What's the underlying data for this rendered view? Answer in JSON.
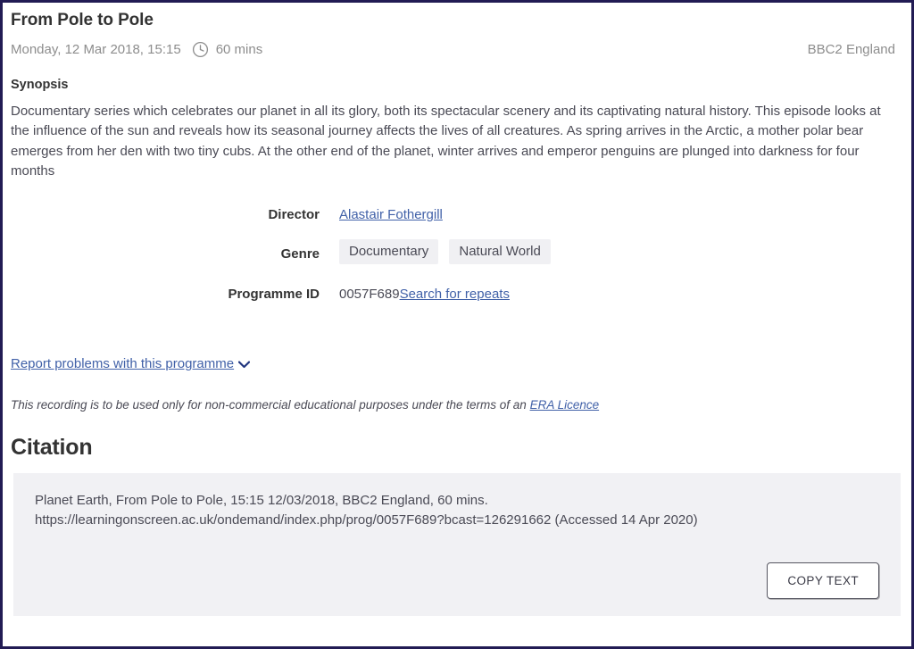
{
  "programme": {
    "title": "From Pole to Pole",
    "broadcast_datetime": "Monday, 12 Mar 2018, 15:15",
    "duration": "60 mins",
    "duration_icon": "clock-icon",
    "channel": "BBC2 England"
  },
  "synopsis": {
    "heading": "Synopsis",
    "text": "Documentary series which celebrates our planet in all its glory, both its spectacular scenery and its captivating natural history. This episode looks at the influence of the sun and reveals how its seasonal journey affects the lives of all creatures. As spring arrives in the Arctic, a mother polar bear emerges from her den with two tiny cubs. At the other end of the planet, winter arrives and emperor penguins are plunged into darkness for four months"
  },
  "details": {
    "director": {
      "label": "Director",
      "value": "Alastair Fothergill"
    },
    "genre": {
      "label": "Genre",
      "chips": [
        "Documentary",
        "Natural World"
      ]
    },
    "programme_id": {
      "label": "Programme ID",
      "value": "0057F689",
      "search_link": "Search for repeats"
    }
  },
  "report": {
    "link_label": "Report problems with this programme",
    "chevron_icon": "chevron-down-icon",
    "chevron_glyph": "⌄"
  },
  "era_notice": {
    "text_before": "This recording is to be used only for non-commercial educational purposes under the terms of an ",
    "link_label": "ERA Licence"
  },
  "citation": {
    "heading": "Citation",
    "line1": "Planet Earth, From Pole to Pole, 15:15 12/03/2018, BBC2 England, 60 mins.",
    "line2": "https://learningonscreen.ac.uk/ondemand/index.php/prog/0057F689?bcast=126291662 (Accessed 14 Apr 2020)",
    "copy_button_label": "COPY TEXT"
  },
  "colors": {
    "window_border": "#221b54",
    "link": "#4161a8",
    "heading": "#333333",
    "body_text": "#4a4a55",
    "muted_text": "#8d8d8d",
    "chip_background": "#f0f0f3",
    "citation_background": "#f1f1f4"
  }
}
